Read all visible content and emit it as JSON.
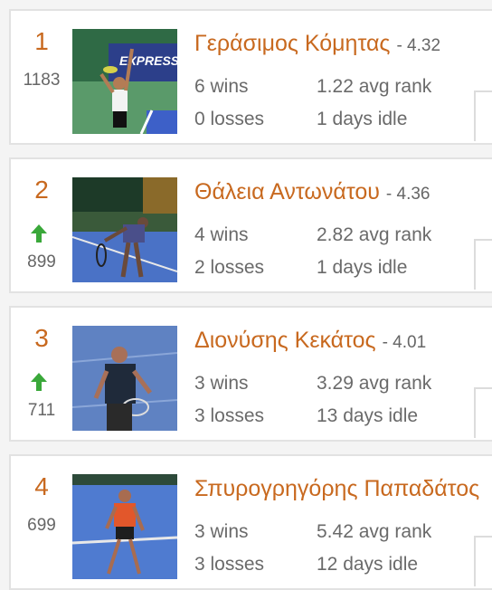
{
  "players": [
    {
      "rank": "1",
      "trend": "none",
      "points": "1183",
      "name": "Γεράσιμος Κόμητας",
      "rating": "- 4.32",
      "wins": "6 wins",
      "losses": "0 losses",
      "avg_rank": "1.22 avg rank",
      "idle": "1 days idle"
    },
    {
      "rank": "2",
      "trend": "up",
      "points": "899",
      "name": "Θάλεια Αντωνάτου",
      "rating": "- 4.36",
      "wins": "4 wins",
      "losses": "2 losses",
      "avg_rank": "2.82 avg rank",
      "idle": "1 days idle"
    },
    {
      "rank": "3",
      "trend": "up",
      "points": "711",
      "name": "Διονύσης Κεκάτος",
      "rating": "- 4.01",
      "wins": "3 wins",
      "losses": "3 losses",
      "avg_rank": "3.29 avg rank",
      "idle": "13 days idle"
    },
    {
      "rank": "4",
      "trend": "none",
      "points": "699",
      "name": "Σπυρογρηγόρης Παπαδάτος",
      "rating": "",
      "wins": "3 wins",
      "losses": "3 losses",
      "avg_rank": "5.42 avg rank",
      "idle": "12 days idle"
    }
  ],
  "colors": {
    "accent": "#c8691f",
    "trend_up": "#3aa83a",
    "muted_text": "#6a6a6a"
  }
}
